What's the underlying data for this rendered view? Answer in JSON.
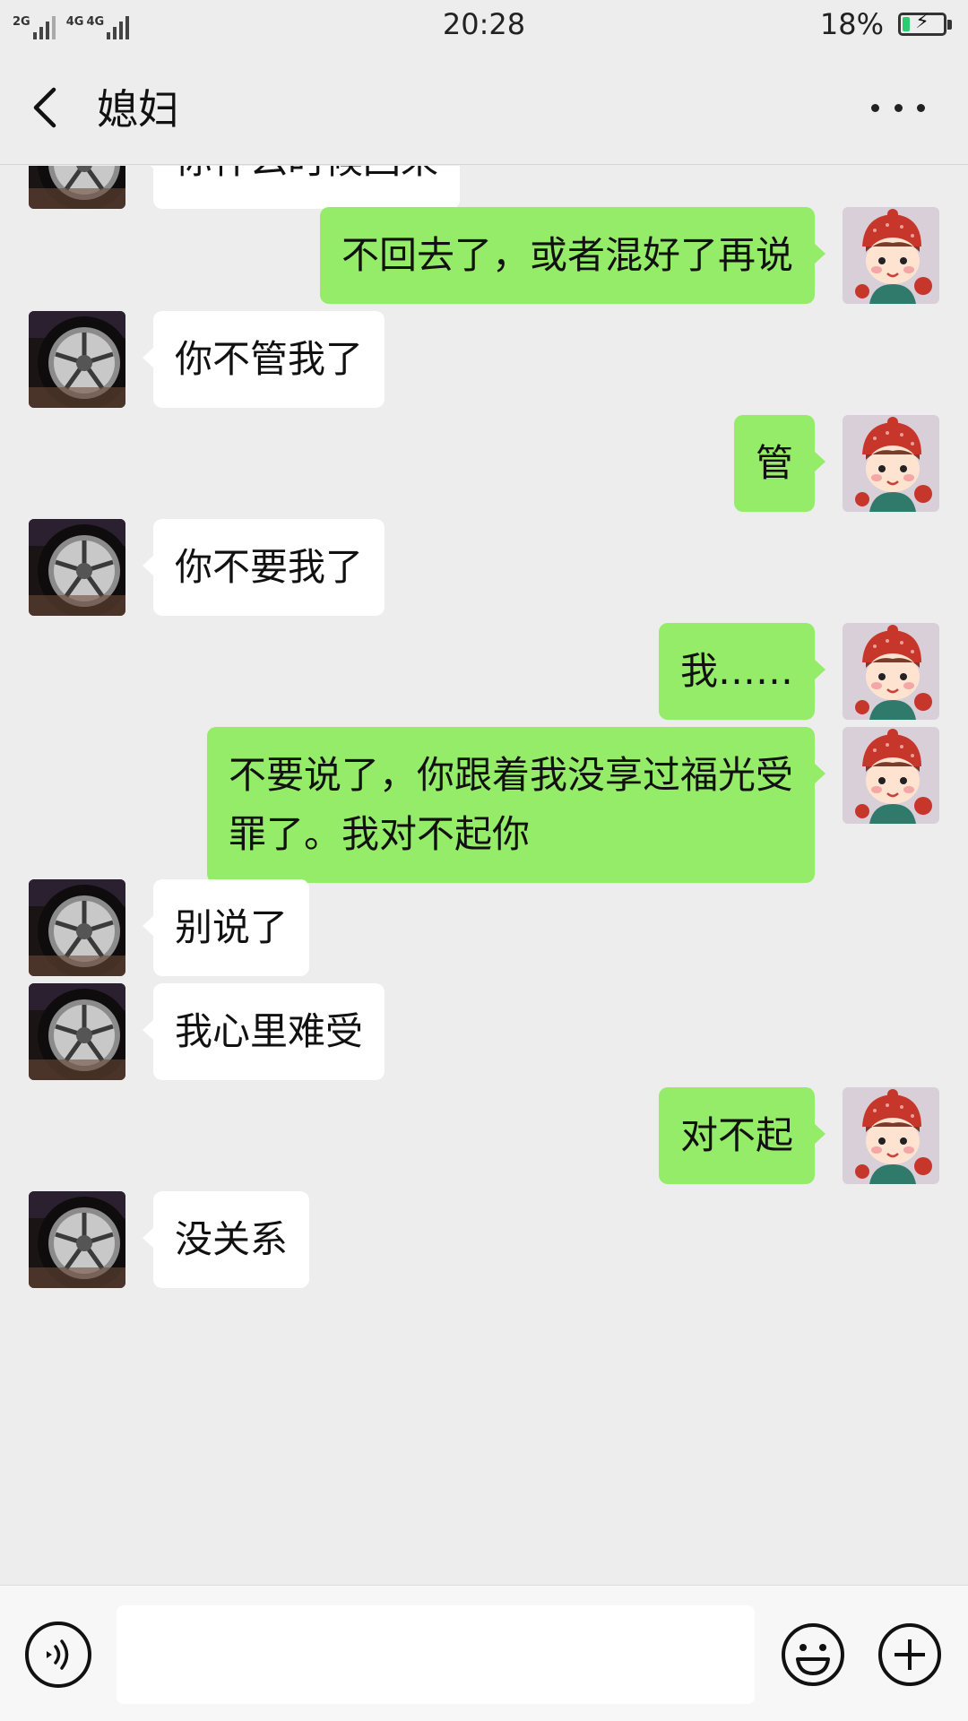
{
  "status_bar": {
    "net1": "2G",
    "net2": "4G",
    "net3": "4G",
    "time": "20:28",
    "battery_percent_text": "18%",
    "battery_level": 0.18
  },
  "nav": {
    "title": "媳妇",
    "back_icon": "back-arrow-icon",
    "more_icon": "more-dots-icon"
  },
  "messages": [
    {
      "side": "left",
      "text": "你什么时候回来"
    },
    {
      "side": "right",
      "text": "不回去了，或者混好了再说"
    },
    {
      "side": "left",
      "text": "你不管我了"
    },
    {
      "side": "right",
      "text": "管"
    },
    {
      "side": "left",
      "text": "你不要我了"
    },
    {
      "side": "right",
      "text": "我……"
    },
    {
      "side": "right",
      "text": "不要说了，你跟着我没享过福光受\n罪了。我对不起你"
    },
    {
      "side": "left",
      "text": "别说了"
    },
    {
      "side": "left",
      "text": "我心里难受"
    },
    {
      "side": "right",
      "text": "对不起"
    },
    {
      "side": "left",
      "text": "没关系"
    }
  ],
  "input_bar": {
    "voice_icon": "voice-icon",
    "input_value": "",
    "emoji_icon": "emoji-icon",
    "plus_icon": "plus-icon"
  },
  "colors": {
    "background": "#ededed",
    "sent_bubble": "#95ec69",
    "received_bubble": "#ffffff"
  }
}
